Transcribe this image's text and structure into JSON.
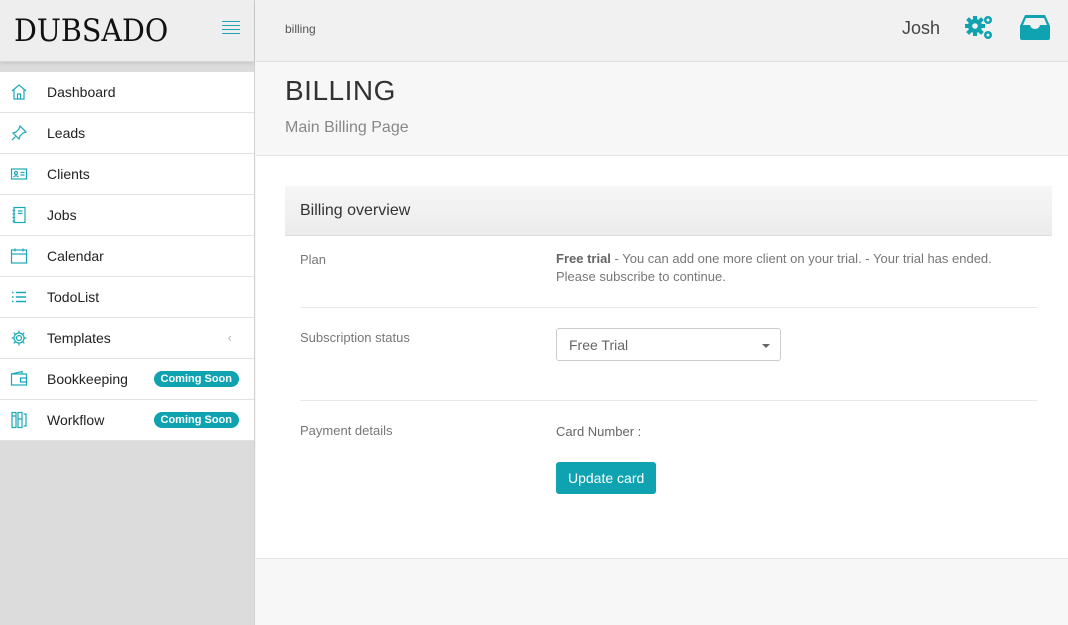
{
  "brand": {
    "name": "DUBSADO"
  },
  "sidebar": {
    "items": [
      {
        "label": "Dashboard",
        "icon": "home-icon"
      },
      {
        "label": "Leads",
        "icon": "pin-icon"
      },
      {
        "label": "Clients",
        "icon": "id-card-icon"
      },
      {
        "label": "Jobs",
        "icon": "notebook-icon"
      },
      {
        "label": "Calendar",
        "icon": "calendar-icon"
      },
      {
        "label": "TodoList",
        "icon": "list-icon"
      },
      {
        "label": "Templates",
        "icon": "gear-icon",
        "chevron": "‹"
      },
      {
        "label": "Bookkeeping",
        "icon": "wallet-icon",
        "badge": "Coming Soon"
      },
      {
        "label": "Workflow",
        "icon": "workflow-icon",
        "badge": "Coming Soon"
      }
    ]
  },
  "topbar": {
    "breadcrumb": "billing",
    "user": "Josh",
    "icons": [
      "gears-icon",
      "inbox-icon"
    ]
  },
  "page": {
    "title": "BILLING",
    "subtitle": "Main Billing Page"
  },
  "panel": {
    "title": "Billing overview",
    "plan": {
      "label": "Plan",
      "bold": "Free trial",
      "line1": " - You can add one more client on your trial. - Your trial has ended.",
      "line2": "Please subscribe to continue."
    },
    "subscription": {
      "label": "Subscription status",
      "selected": "Free Trial"
    },
    "payment": {
      "label": "Payment details",
      "card_label": "Card Number :",
      "button": "Update card"
    }
  },
  "colors": {
    "accent": "#0fa3b1",
    "sidebar_bg": "#dcdcdc"
  }
}
